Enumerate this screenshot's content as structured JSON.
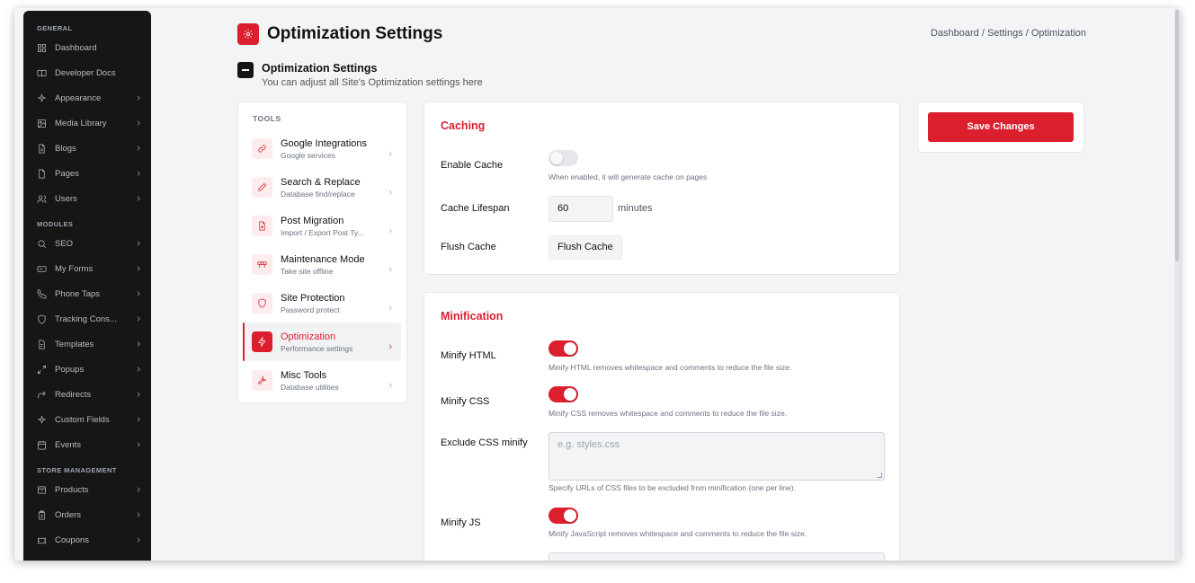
{
  "sidebar": {
    "sections": [
      {
        "title": "GENERAL",
        "items": [
          {
            "label": "Dashboard",
            "icon": "dashboard-icon",
            "chevron": false
          },
          {
            "label": "Developer Docs",
            "icon": "book-icon",
            "chevron": false
          },
          {
            "label": "Appearance",
            "icon": "sparkle-icon",
            "chevron": true
          },
          {
            "label": "Media Library",
            "icon": "image-icon",
            "chevron": true
          },
          {
            "label": "Blogs",
            "icon": "document-icon",
            "chevron": true
          },
          {
            "label": "Pages",
            "icon": "page-icon",
            "chevron": true
          },
          {
            "label": "Users",
            "icon": "users-icon",
            "chevron": true
          }
        ]
      },
      {
        "title": "MODULES",
        "items": [
          {
            "label": "SEO",
            "icon": "search-icon",
            "chevron": true
          },
          {
            "label": "My Forms",
            "icon": "form-icon",
            "chevron": true
          },
          {
            "label": "Phone Taps",
            "icon": "phone-icon",
            "chevron": true
          },
          {
            "label": "Tracking Cons...",
            "icon": "shield-icon",
            "chevron": true
          },
          {
            "label": "Templates",
            "icon": "template-icon",
            "chevron": true
          },
          {
            "label": "Popups",
            "icon": "expand-icon",
            "chevron": true
          },
          {
            "label": "Redirects",
            "icon": "redirect-icon",
            "chevron": true
          },
          {
            "label": "Custom Fields",
            "icon": "sparkle-icon",
            "chevron": true
          },
          {
            "label": "Events",
            "icon": "calendar-icon",
            "chevron": true
          }
        ]
      },
      {
        "title": "STORE MANAGEMENT",
        "items": [
          {
            "label": "Products",
            "icon": "box-icon",
            "chevron": true
          },
          {
            "label": "Orders",
            "icon": "clipboard-icon",
            "chevron": true
          },
          {
            "label": "Coupons",
            "icon": "ticket-icon",
            "chevron": true
          }
        ]
      }
    ]
  },
  "header": {
    "title": "Optimization Settings",
    "breadcrumb": "Dashboard / Settings / Optimization"
  },
  "section": {
    "title": "Optimization Settings",
    "subtitle": "You can adjust all Site's Optimization settings here"
  },
  "tools": {
    "heading": "TOOLS",
    "items": [
      {
        "name": "Google Integrations",
        "desc": "Google services",
        "icon": "link-icon",
        "active": false
      },
      {
        "name": "Search & Replace",
        "desc": "Database find/replace",
        "icon": "pencil-icon",
        "active": false
      },
      {
        "name": "Post Migration",
        "desc": "Import / Export Post Ty...",
        "icon": "file-import-icon",
        "active": false
      },
      {
        "name": "Maintenance Mode",
        "desc": "Take site offline",
        "icon": "barrier-icon",
        "active": false
      },
      {
        "name": "Site Protection",
        "desc": "Password protect",
        "icon": "shield-icon",
        "active": false
      },
      {
        "name": "Optimization",
        "desc": "Performance settings",
        "icon": "bolt-icon",
        "active": true
      },
      {
        "name": "Misc Tools",
        "desc": "Database utilities",
        "icon": "wrench-icon",
        "active": false
      }
    ]
  },
  "caching": {
    "title": "Caching",
    "enable_label": "Enable Cache",
    "enable_on": false,
    "enable_help": "When enabled, it will generate cache on pages",
    "lifespan_label": "Cache Lifespan",
    "lifespan_value": "60",
    "lifespan_unit": "minutes",
    "flush_label": "Flush Cache",
    "flush_button": "Flush Cache"
  },
  "minification": {
    "title": "Minification",
    "html_label": "Minify HTML",
    "html_on": true,
    "html_help": "Minify HTML removes whitespace and comments to reduce the file size.",
    "css_label": "Minify CSS",
    "css_on": true,
    "css_help": "Minify CSS removes whitespace and comments to reduce the file size.",
    "exclude_css_label": "Exclude CSS minify",
    "exclude_css_placeholder": "e.g. styles.css",
    "exclude_css_help": "Specify URLs of CSS files to be excluded from minification (one per line).",
    "js_label": "Minify JS",
    "js_on": true,
    "js_help": "Minify JavaScript removes whitespace and comments to reduce the file size."
  },
  "actions": {
    "save_label": "Save Changes"
  },
  "colors": {
    "accent": "#dc1f2e",
    "sidebar_bg": "#161616",
    "page_bg": "#f3f4f6"
  }
}
